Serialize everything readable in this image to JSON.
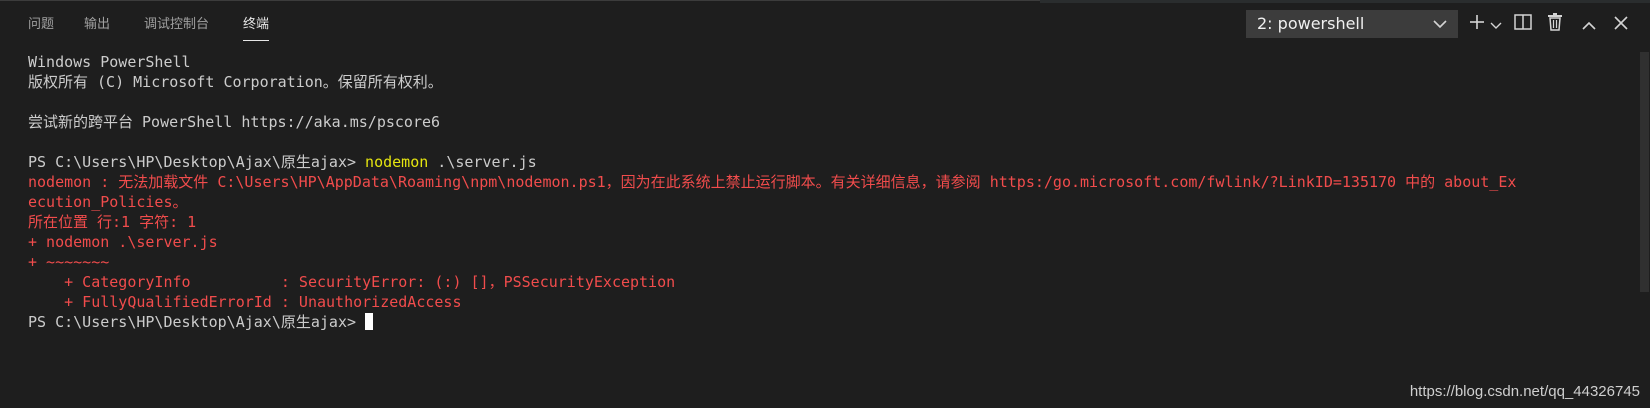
{
  "panel": {
    "tabs": [
      {
        "label": "问题"
      },
      {
        "label": "输出"
      },
      {
        "label": "调试控制台"
      },
      {
        "label": "终端",
        "active": true
      }
    ],
    "terminal_selector": {
      "value": "2: powershell"
    },
    "toolbar": {
      "icons": [
        "plus-icon",
        "chevron-down-icon",
        "split-terminal-icon",
        "trash-icon",
        "chevron-up-icon",
        "close-icon"
      ]
    }
  },
  "terminal": {
    "lines": [
      "Windows PowerShell",
      "版权所有 (C) Microsoft Corporation。保留所有权利。",
      "",
      "尝试新的跨平台 PowerShell https://aka.ms/pscore6",
      "",
      "PS C:\\Users\\HP\\Desktop\\Ajax\\原生ajax>",
      "nodemon : 无法加载文件 C:\\Users\\HP\\AppData\\Roaming\\npm\\nodemon.ps1，因为在此系统上禁止运行脚本。有关详细信息，请参阅 https:/go.microsoft.com/fwlink/?LinkID=135170 中的 about_Ex",
      "ecution_Policies。",
      "所在位置 行:1 字符: 1",
      "+ nodemon .\\server.js",
      "+ ~~~~~~~",
      "    + CategoryInfo          : SecurityError: (:) []，PSSecurityException",
      "    + FullyQualifiedErrorId : UnauthorizedAccess",
      "PS C:\\Users\\HP\\Desktop\\Ajax\\原生ajax>"
    ],
    "command": {
      "name": "nodemon",
      "args": ".\\server.js"
    }
  },
  "watermark": "https://blog.csdn.net/qq_44326745",
  "colors": {
    "background": "#1e1e1e",
    "text": "#cccccc",
    "error": "#f14c4c",
    "command": "#e5e510"
  }
}
